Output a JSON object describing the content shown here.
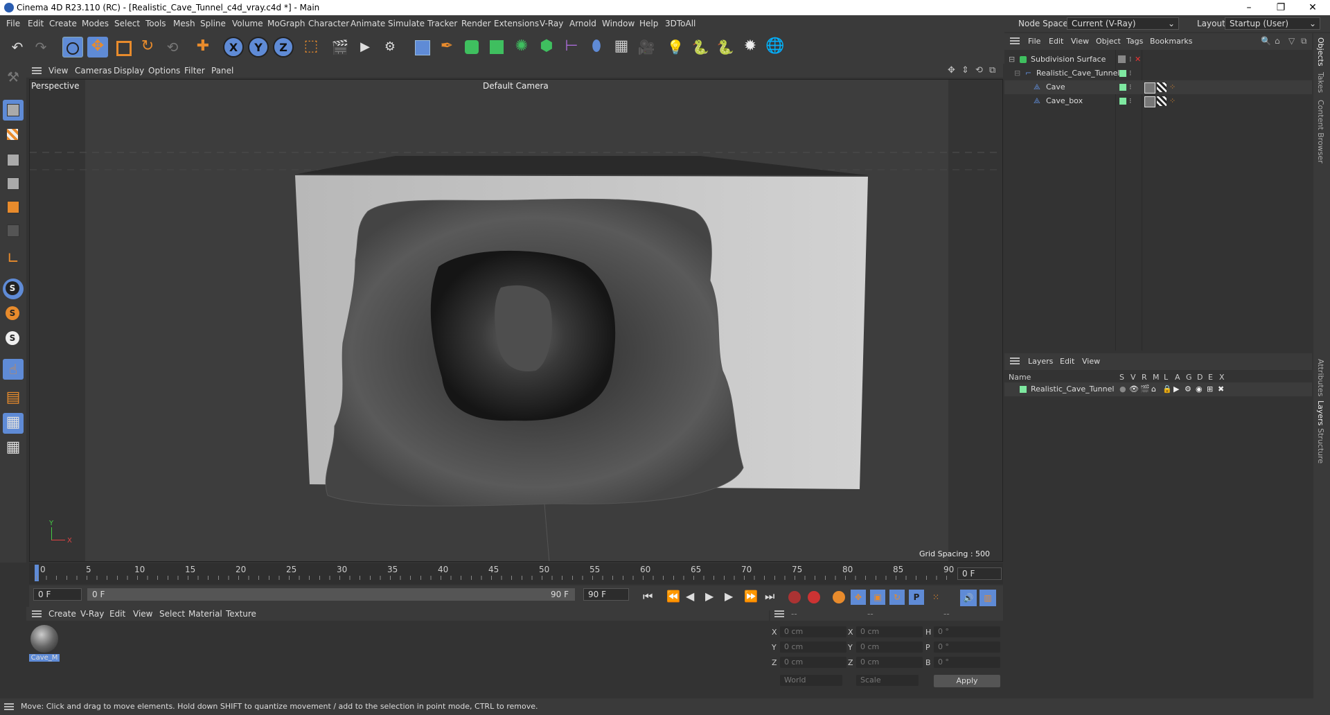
{
  "window": {
    "title": "Cinema 4D R23.110 (RC) - [Realistic_Cave_Tunnel_c4d_vray.c4d *] - Main",
    "minimize": "–",
    "maximize": "❐",
    "close": "✕"
  },
  "menubar": [
    "File",
    "Edit",
    "Create",
    "Modes",
    "Select",
    "Tools",
    "Mesh",
    "Spline",
    "Volume",
    "MoGraph",
    "Character",
    "Animate",
    "Simulate",
    "Tracker",
    "Render",
    "Extensions",
    "V-Ray",
    "Arnold",
    "Window",
    "Help",
    "3DToAll"
  ],
  "nodespace": {
    "label": "Node Space:",
    "value": "Current (V-Ray)",
    "layout_label": "Layout:",
    "layout_value": "Startup (User)"
  },
  "toolbar": {
    "axis_x": "X",
    "axis_y": "Y",
    "axis_z": "Z"
  },
  "viewport": {
    "menu": [
      "View",
      "Cameras",
      "Display",
      "Options",
      "Filter",
      "Panel"
    ],
    "label": "Perspective",
    "camera": "Default Camera",
    "grid_spacing": "Grid Spacing : 500 cm",
    "axis_y": "Y",
    "axis_x": "X"
  },
  "timeline": {
    "ticks": [
      "0",
      "5",
      "10",
      "15",
      "20",
      "25",
      "30",
      "35",
      "40",
      "45",
      "50",
      "55",
      "60",
      "65",
      "70",
      "75",
      "80",
      "85",
      "90"
    ],
    "current_frame": "0 F",
    "start_field": "0 F",
    "range_start": "0 F",
    "range_end": "90 F",
    "end_field": "90 F"
  },
  "material_manager": {
    "menu": [
      "Create",
      "V-Ray",
      "Edit",
      "View",
      "Select",
      "Material",
      "Texture"
    ],
    "materials": [
      {
        "name": "Cave_M"
      }
    ]
  },
  "coordinates": {
    "header": [
      "--",
      "--",
      "--"
    ],
    "rows": [
      {
        "a": "X",
        "av": "0 cm",
        "b": "X",
        "bv": "0 cm",
        "c": "H",
        "cv": "0 °"
      },
      {
        "a": "Y",
        "av": "0 cm",
        "b": "Y",
        "bv": "0 cm",
        "c": "P",
        "cv": "0 °"
      },
      {
        "a": "Z",
        "av": "0 cm",
        "b": "Z",
        "bv": "0 cm",
        "c": "B",
        "cv": "0 °"
      }
    ],
    "world": "World",
    "scale": "Scale",
    "apply": "Apply"
  },
  "status": "Move: Click and drag to move elements. Hold down SHIFT to quantize movement / add to the selection in point mode, CTRL to remove.",
  "object_manager": {
    "menu": [
      "File",
      "Edit",
      "View",
      "Object",
      "Tags",
      "Bookmarks"
    ],
    "objects": [
      {
        "name": "Subdivision Surface"
      },
      {
        "name": "Realistic_Cave_Tunnel"
      },
      {
        "name": "Cave"
      },
      {
        "name": "Cave_box"
      }
    ]
  },
  "layer_manager": {
    "menu": [
      "Layers",
      "Edit",
      "View"
    ],
    "name_header": "Name",
    "flags": [
      "S",
      "V",
      "R",
      "M",
      "L",
      "A",
      "G",
      "D",
      "E",
      "X"
    ],
    "layers": [
      {
        "name": "Realistic_Cave_Tunnel",
        "color": "#7ee8a0"
      }
    ]
  },
  "side_tabs": [
    "Objects",
    "Takes",
    "Content Browser",
    "Attributes",
    "Layers",
    "Structure"
  ],
  "colors": {
    "accent": "#5f8bd6",
    "layer_green": "#7ee8a0",
    "orange": "#e88b2c"
  }
}
